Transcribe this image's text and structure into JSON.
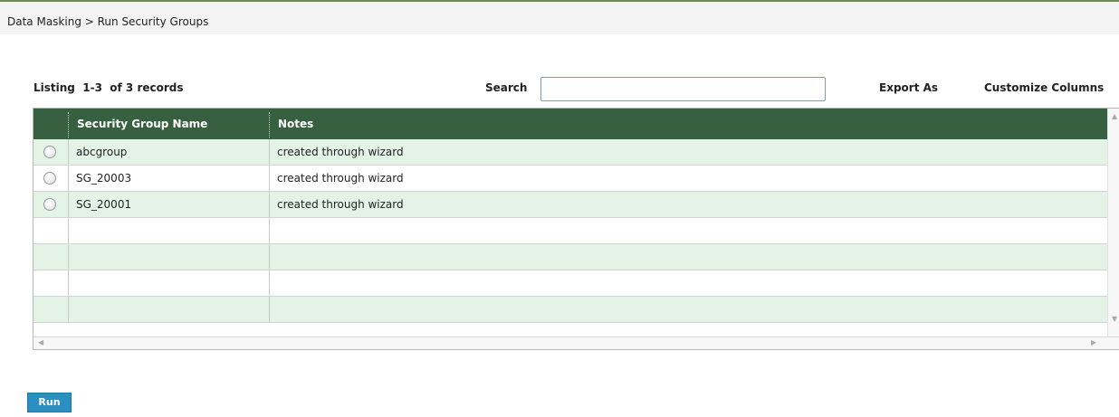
{
  "breadcrumb": "Data Masking > Run Security Groups",
  "listing": "Listing  1-3  of 3 records",
  "search": {
    "label": "Search",
    "value": "",
    "placeholder": ""
  },
  "toolbar": {
    "export_label": "Export As",
    "customize_label": "Customize Columns"
  },
  "table": {
    "columns": [
      "",
      "Security Group Name",
      "Notes"
    ],
    "rows": [
      {
        "name": "abcgroup",
        "notes": "created through wizard",
        "selected": false
      },
      {
        "name": "SG_20003",
        "notes": "created through wizard",
        "selected": false
      },
      {
        "name": "SG_20001",
        "notes": "created through wizard",
        "selected": false
      }
    ],
    "empty_rows": 4
  },
  "icons": {
    "radio": "radio-button-icon",
    "scroll_up": "scroll-up-arrow-icon",
    "scroll_down": "scroll-down-arrow-icon",
    "scroll_left": "scroll-left-arrow-icon",
    "scroll_right": "scroll-right-arrow-icon"
  },
  "colors": {
    "header_bg": "#36603f",
    "alt_row": "#e3f3e6",
    "run_button": "#2b8fc1",
    "breadcrumb_bar": "#f3f3f3"
  },
  "actions": {
    "run_label": "Run"
  }
}
